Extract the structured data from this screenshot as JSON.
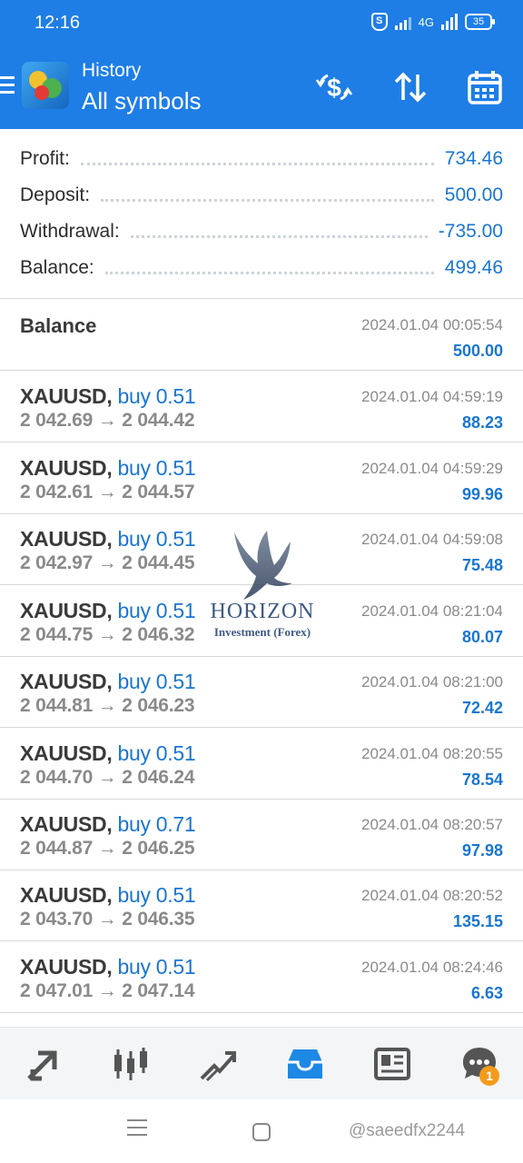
{
  "status_bar": {
    "time": "12:16",
    "shield": "S",
    "network": "4G",
    "battery": "35"
  },
  "header": {
    "subtitle": "History",
    "title": "All symbols"
  },
  "toolbar": {
    "icons": [
      "dollar-refresh-icon",
      "sort-icon",
      "calendar-icon"
    ]
  },
  "summary": [
    {
      "label": "Profit:",
      "value": "734.46"
    },
    {
      "label": "Deposit:",
      "value": "500.00"
    },
    {
      "label": "Withdrawal:",
      "value": "-735.00"
    },
    {
      "label": "Balance:",
      "value": "499.46"
    }
  ],
  "balance_entry": {
    "title": "Balance",
    "time": "2024.01.04 00:05:54",
    "amount": "500.00"
  },
  "deals": [
    {
      "symbol": "XAUUSD,",
      "type": "buy 0.51",
      "prices": "2 042.69 → 2 044.42",
      "time": "2024.01.04 04:59:19",
      "profit": "88.23"
    },
    {
      "symbol": "XAUUSD,",
      "type": "buy 0.51",
      "prices": "2 042.61 → 2 044.57",
      "time": "2024.01.04 04:59:29",
      "profit": "99.96"
    },
    {
      "symbol": "XAUUSD,",
      "type": "buy 0.51",
      "prices": "2 042.97 → 2 044.45",
      "time": "2024.01.04 04:59:08",
      "profit": "75.48"
    },
    {
      "symbol": "XAUUSD,",
      "type": "buy 0.51",
      "prices": "2 044.75 → 2 046.32",
      "time": "2024.01.04 08:21:04",
      "profit": "80.07"
    },
    {
      "symbol": "XAUUSD,",
      "type": "buy 0.51",
      "prices": "2 044.81 → 2 046.23",
      "time": "2024.01.04 08:21:00",
      "profit": "72.42"
    },
    {
      "symbol": "XAUUSD,",
      "type": "buy 0.51",
      "prices": "2 044.70 → 2 046.24",
      "time": "2024.01.04 08:20:55",
      "profit": "78.54"
    },
    {
      "symbol": "XAUUSD,",
      "type": "buy 0.71",
      "prices": "2 044.87 → 2 046.25",
      "time": "2024.01.04 08:20:57",
      "profit": "97.98"
    },
    {
      "symbol": "XAUUSD,",
      "type": "buy 0.51",
      "prices": "2 043.70 → 2 046.35",
      "time": "2024.01.04 08:20:52",
      "profit": "135.15"
    },
    {
      "symbol": "XAUUSD,",
      "type": "buy 0.51",
      "prices": "2 047.01 → 2 047.14",
      "time": "2024.01.04 08:24:46",
      "profit": "6.63"
    }
  ],
  "watermark": {
    "brand": "HORIZON",
    "tagline": "Investment (Forex)"
  },
  "bottom_nav": {
    "items": [
      "quotes-icon",
      "chart-icon",
      "trade-icon",
      "history-icon",
      "news-icon",
      "messages-icon"
    ],
    "active": "history-icon",
    "messages_badge": "1"
  },
  "footer_handle": "@saeedfx2244",
  "colors": {
    "header_bg": "#1e7ee6",
    "accent": "#1976d2",
    "badge": "#f59b1b"
  }
}
